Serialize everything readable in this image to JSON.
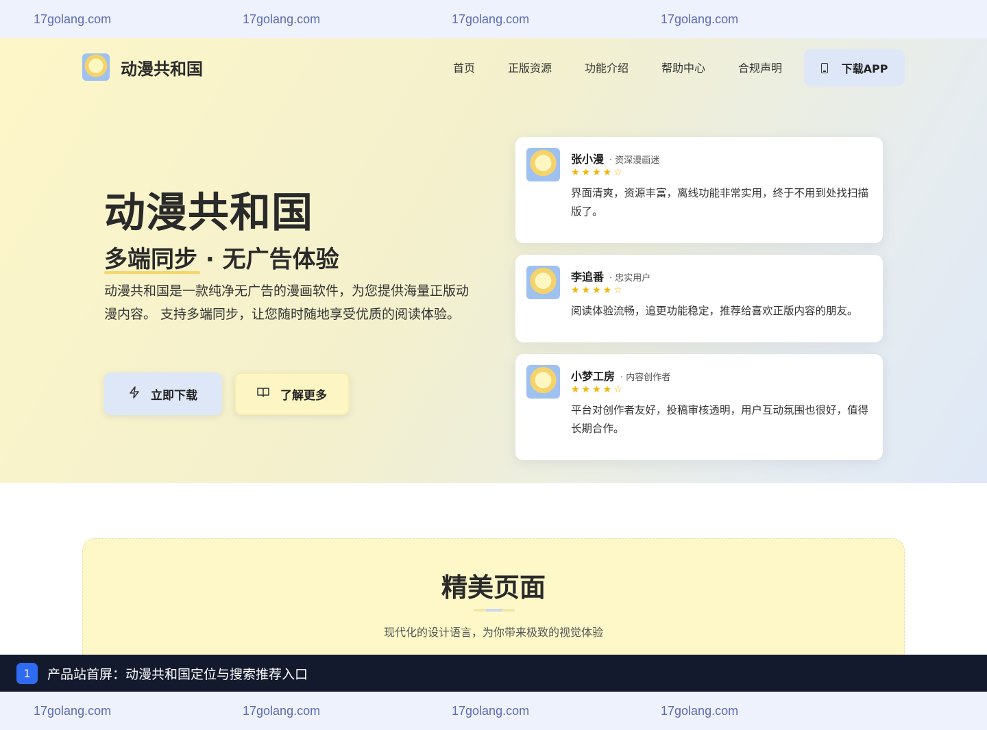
{
  "watermark": {
    "items": [
      "17golang.com",
      "17golang.com",
      "17golang.com",
      "17golang.com"
    ]
  },
  "nav": {
    "brand": "动漫共和国",
    "links": [
      "首页",
      "正版资源",
      "功能介绍",
      "帮助中心",
      "合规声明"
    ],
    "download_app": "下载APP"
  },
  "hero": {
    "title": "动漫共和国",
    "subtitle": "多端同步 · 无广告体验",
    "description": "动漫共和国是一款纯净无广告的漫画软件，为您提供海量正版动漫内容。 支持多端同步，让您随时随地享受优质的阅读体验。",
    "download_button": "立即下载",
    "learn_more_button": "了解更多",
    "download_icon": "lightning-icon",
    "learn_more_icon": "book-icon"
  },
  "reviews": [
    {
      "name": "张小漫",
      "role": "· 资深漫画迷",
      "rating": 4,
      "text": "界面清爽，资源丰富，离线功能非常实用，终于不用到处找扫描版了。"
    },
    {
      "name": "李追番",
      "role": "· 忠实用户",
      "rating": 4,
      "text": "阅读体验流畅，追更功能稳定，推荐给喜欢正版内容的朋友。"
    },
    {
      "name": "小梦工房",
      "role": "· 内容创作者",
      "rating": 4,
      "text": "平台对创作者友好，投稿审核透明，用户互动氛围也很好，值得长期合作。"
    }
  ],
  "section": {
    "title": "精美页面",
    "description": "现代化的设计语言，为你带来极致的视觉体验"
  },
  "caption": {
    "number": "1",
    "text": "产品站首屏：动漫共和国定位与搜索推荐入口"
  },
  "colors": {
    "accent_yellow": "#f6d56a",
    "accent_blue": "#dde7f7",
    "star": "#f4b400",
    "caption_bg": "#141a2e",
    "badge": "#2f6bf2"
  }
}
